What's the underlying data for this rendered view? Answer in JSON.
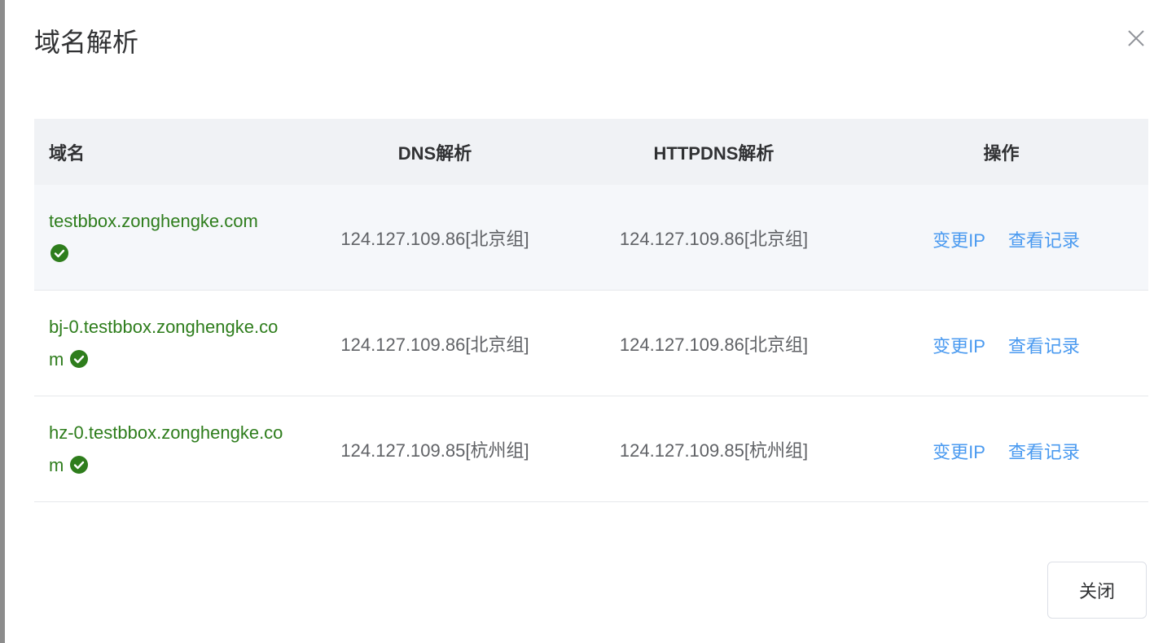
{
  "dialog": {
    "title": "域名解析",
    "close_icon": "close-icon",
    "footer": {
      "close_label": "关闭"
    }
  },
  "table": {
    "headers": {
      "domain": "域名",
      "dns": "DNS解析",
      "httpdns": "HTTPDNS解析",
      "ops": "操作"
    },
    "rows": [
      {
        "domain": "testbbox.zonghengke.com",
        "status_icon": "check-circle-icon",
        "dns": "124.127.109.86[北京组]",
        "httpdns": "124.127.109.86[北京组]",
        "change_ip": "变更IP",
        "view_records": "查看记录"
      },
      {
        "domain": "bj-0.testbbox.zonghengke.com",
        "status_icon": "check-circle-icon",
        "dns": "124.127.109.86[北京组]",
        "httpdns": "124.127.109.86[北京组]",
        "change_ip": "变更IP",
        "view_records": "查看记录"
      },
      {
        "domain": "hz-0.testbbox.zonghengke.com",
        "status_icon": "check-circle-icon",
        "dns": "124.127.109.85[杭州组]",
        "httpdns": "124.127.109.85[杭州组]",
        "change_ip": "变更IP",
        "view_records": "查看记录"
      }
    ]
  },
  "colors": {
    "domain_text": "#2e7d1c",
    "check_icon": "#2e7d1c",
    "link": "#4a9af0",
    "header_bg": "#f0f2f5",
    "hover_row_bg": "#f5f7fa"
  }
}
